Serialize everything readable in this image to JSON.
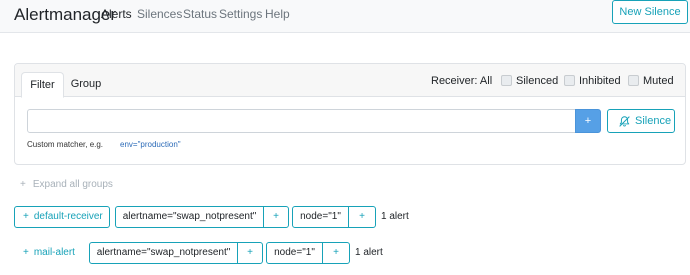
{
  "navbar": {
    "brand": "Alertmanager",
    "links": [
      {
        "label": "Alerts"
      },
      {
        "label": "Silences"
      },
      {
        "label": "Status"
      },
      {
        "label": "Settings"
      },
      {
        "label": "Help"
      }
    ],
    "new_silence_label": "New Silence"
  },
  "filter": {
    "tabs": [
      {
        "label": "Filter",
        "active": true
      },
      {
        "label": "Group",
        "active": false
      }
    ],
    "receiver_label": "Receiver: All",
    "checkboxes": [
      {
        "label": "Silenced",
        "checked": false
      },
      {
        "label": "Inhibited",
        "checked": false
      },
      {
        "label": "Muted",
        "checked": false
      }
    ],
    "input_value": "",
    "add_label": "+",
    "silence_label": "Silence",
    "hint_text": "Custom matcher, e.g.",
    "hint_example": "env=\"production\""
  },
  "expand_all": {
    "icon": "+",
    "label": "Expand all groups"
  },
  "groups": [
    {
      "receiver": "default-receiver",
      "matchers": [
        {
          "label": "alertname=\"swap_notpresent\"",
          "add": "+"
        },
        {
          "label": "node=\"1\"",
          "add": "+"
        }
      ],
      "count": "1 alert"
    },
    {
      "receiver": "mail-alert",
      "matchers": [
        {
          "label": "alertname=\"swap_notpresent\"",
          "add": "+"
        },
        {
          "label": "node=\"1\"",
          "add": "+"
        }
      ],
      "count": "1 alert"
    }
  ],
  "colors": {
    "accent": "#17a2b8",
    "primary_button": "#56a0e6",
    "navbar_bg": "#f8f9fa",
    "muted_text": "#a8b1b9"
  },
  "icons": {
    "silence": "bell-slash-icon",
    "expand": "plus-icon"
  }
}
